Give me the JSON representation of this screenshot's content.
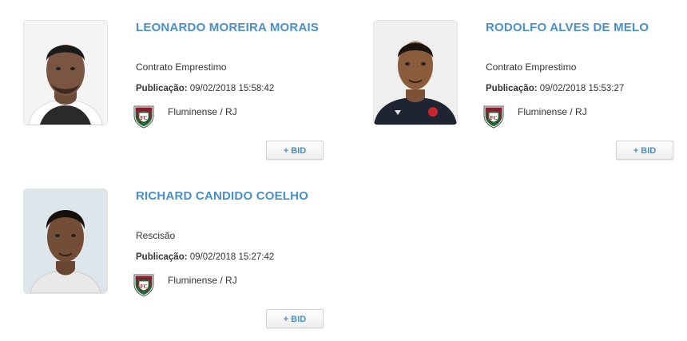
{
  "players": [
    {
      "name": "LEONARDO MOREIRA MORAIS",
      "contract_type": "Contrato Emprestimo",
      "publication_label": "Publicação:",
      "publication_date": "09/02/2018 15:58:42",
      "club": "Fluminense / RJ",
      "bid_label": "+ BID"
    },
    {
      "name": "RODOLFO ALVES DE MELO",
      "contract_type": "Contrato Emprestimo",
      "publication_label": "Publicação:",
      "publication_date": "09/02/2018 15:53:27",
      "club": "Fluminense / RJ",
      "bid_label": "+ BID"
    },
    {
      "name": "RICHARD CANDIDO COELHO",
      "contract_type": "Rescisão",
      "publication_label": "Publicação:",
      "publication_date": "09/02/2018 15:27:42",
      "club": "Fluminense / RJ",
      "bid_label": "+ BID"
    }
  ],
  "colors": {
    "accent": "#4a90c8",
    "crest_green": "#1e6b3a",
    "crest_maroon": "#8b1a2b"
  }
}
